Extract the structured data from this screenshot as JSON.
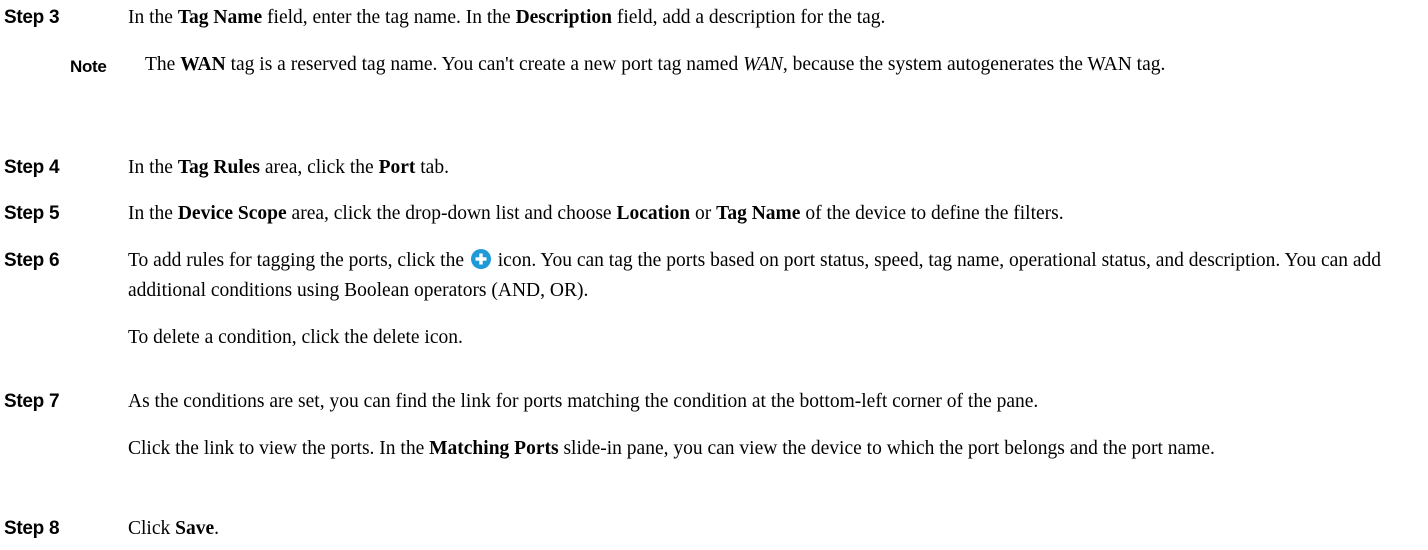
{
  "steps": [
    {
      "label": "Step 3",
      "paras": [
        [
          "In the ",
          "Tag Name",
          " field, enter the tag name. In the ",
          "Description",
          " field, add a description for the tag."
        ]
      ],
      "note": {
        "label": "Note",
        "text": [
          "The ",
          "WAN",
          " tag is a reserved tag name. You can't create a new port tag named ",
          "WAN",
          ", because the system autogenerates the WAN tag."
        ]
      }
    },
    {
      "label": "Step 4",
      "paras": [
        [
          "In the ",
          "Tag Rules",
          " area, click the ",
          "Port",
          " tab."
        ]
      ]
    },
    {
      "label": "Step 5",
      "paras": [
        [
          "In the ",
          "Device Scope",
          " area, click the drop-down list and choose ",
          "Location",
          " or ",
          "Tag Name",
          " of the device to define the filters."
        ]
      ]
    },
    {
      "label": "Step 6",
      "paras": [
        [
          "To add rules for tagging the ports, click the ",
          " icon. You can tag the ports based on port status, speed, tag name, operational status, and description. You can add additional conditions using Boolean operators (AND, OR)."
        ],
        [
          "To delete a condition, click the delete icon."
        ]
      ]
    },
    {
      "label": "Step 7",
      "paras": [
        [
          "As the conditions are set, you can find the link for ports matching the condition at the bottom-left corner of the pane."
        ],
        [
          "Click the link to view the ports. In the ",
          "Matching Ports",
          " slide-in pane, you can view the device to which the port belongs and the port name."
        ]
      ]
    },
    {
      "label": "Step 8",
      "paras": [
        [
          "Click ",
          "Save",
          "."
        ]
      ]
    }
  ],
  "icons": {
    "add": "plus-circle-icon",
    "add_color": "#1e9bd7"
  }
}
